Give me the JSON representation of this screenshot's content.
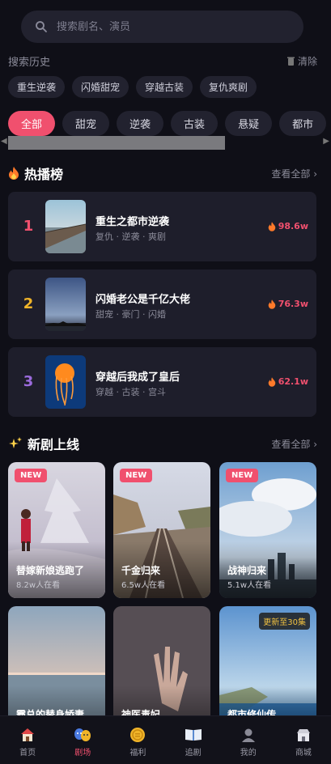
{
  "search": {
    "placeholder": "搜索剧名、演员"
  },
  "history": {
    "title": "搜索历史",
    "clear_label": "清除",
    "tags": [
      "重生逆袭",
      "闪婚甜宠",
      "穿越古装",
      "复仇爽剧"
    ]
  },
  "categories": {
    "items": [
      "全部",
      "甜宠",
      "逆袭",
      "古装",
      "悬疑",
      "都市"
    ],
    "active": "全部"
  },
  "hot": {
    "title": "热播榜",
    "see_all": "查看全部 ›",
    "items": [
      {
        "rank": "1",
        "title": "重生之都市逆袭",
        "tags": "复仇 · 逆袭 · 爽剧",
        "heat": "98.6w",
        "rank_color": "#f0506e"
      },
      {
        "rank": "2",
        "title": "闪婚老公是千亿大佬",
        "tags": "甜宠 · 豪门 · 闪婚",
        "heat": "76.3w",
        "rank_color": "#f0b429"
      },
      {
        "rank": "3",
        "title": "穿越后我成了皇后",
        "tags": "穿越 · 古装 · 宫斗",
        "heat": "62.1w",
        "rank_color": "#9b6bdc"
      }
    ]
  },
  "new_release": {
    "title": "新剧上线",
    "see_all": "查看全部 ›",
    "badge_new": "NEW",
    "cards": [
      {
        "title": "替嫁新娘逃跑了",
        "viewers": "8.2w人在看",
        "badge": "NEW"
      },
      {
        "title": "千金归来",
        "viewers": "6.5w人在看",
        "badge": "NEW"
      },
      {
        "title": "战神归来",
        "viewers": "5.1w人在看",
        "badge": "NEW"
      },
      {
        "title": "霸总的替身娇妻",
        "viewers": "",
        "badge": ""
      },
      {
        "title": "神医毒妃",
        "viewers": "",
        "badge": ""
      },
      {
        "title": "都市修仙传",
        "viewers": "",
        "badge": "更新至30集"
      }
    ]
  },
  "nav": {
    "items": [
      "首页",
      "剧场",
      "福利",
      "追剧",
      "我的",
      "商城"
    ],
    "active": "剧场"
  },
  "colors": {
    "accent": "#f0506e",
    "background": "#0f0f17",
    "card": "#1e1e2b"
  }
}
